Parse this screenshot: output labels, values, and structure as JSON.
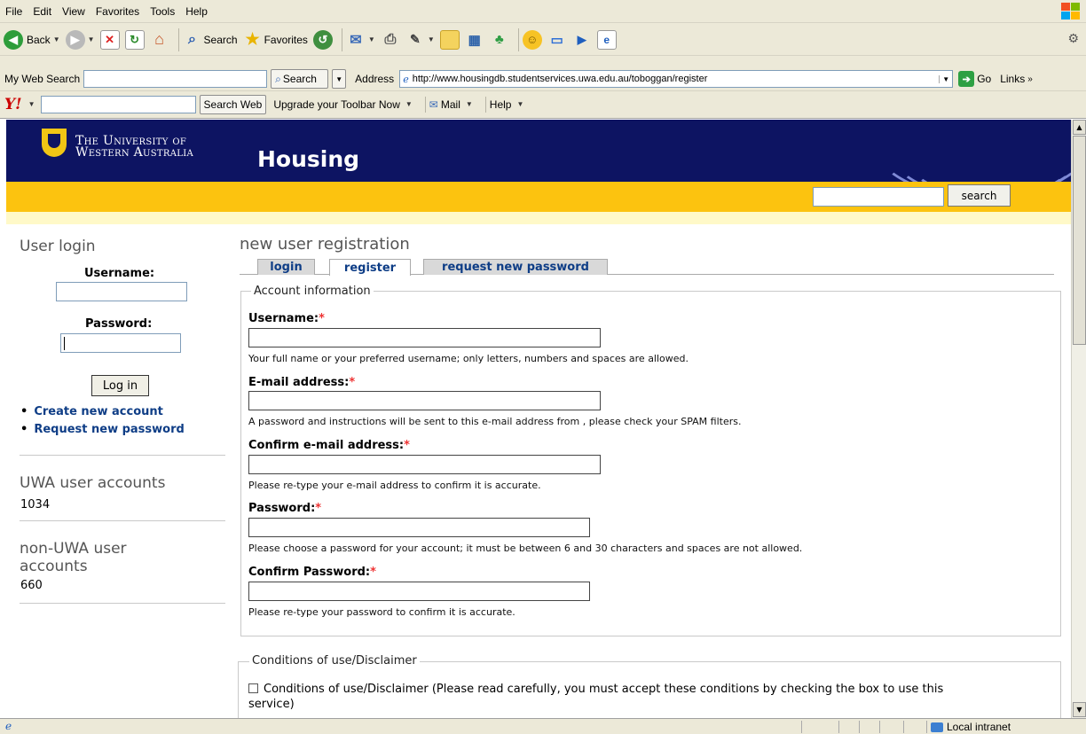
{
  "browser": {
    "menu": [
      "File",
      "Edit",
      "View",
      "Favorites",
      "Tools",
      "Help"
    ],
    "toolbar": {
      "back": "Back",
      "search": "Search",
      "favorites": "Favorites"
    },
    "address_bar": {
      "my_web_search": "My Web Search",
      "search_button": "Search",
      "address_label": "Address",
      "url": "http://www.housingdb.studentservices.uwa.edu.au/toboggan/register",
      "go": "Go",
      "links": "Links"
    },
    "yahoo_bar": {
      "logo": "Y!",
      "search_web": "Search Web",
      "upgrade": "Upgrade your Toolbar Now",
      "mail": "Mail",
      "help": "Help"
    },
    "status": {
      "zone": "Local intranet"
    }
  },
  "header": {
    "university_line1": "The University of",
    "university_line2": "Western Australia",
    "site_title": "Housing",
    "search_button": "search"
  },
  "sidebar": {
    "login_title": "User login",
    "username_label": "Username:",
    "password_label": "Password:",
    "login_button": "Log in",
    "links": [
      "Create new account",
      "Request new password"
    ],
    "uwa_title": "UWA user accounts",
    "uwa_count": "1034",
    "non_uwa_title_line1": "non-UWA user",
    "non_uwa_title_line2": "accounts",
    "non_uwa_count": "660"
  },
  "main": {
    "title": "new user registration",
    "tabs": [
      "login",
      "register",
      "request new password"
    ],
    "account_legend": "Account information",
    "fields": [
      {
        "label": "Username:",
        "hint": "Your full name or your preferred username; only letters, numbers and spaces are allowed."
      },
      {
        "label": "E-mail address:",
        "hint": "A password and instructions will be sent to this e-mail address from , please check your SPAM filters."
      },
      {
        "label": "Confirm e-mail address:",
        "hint": "Please re-type your e-mail address to confirm it is accurate."
      },
      {
        "label": "Password:",
        "hint": "Please choose a password for your account; it must be between 6 and 30 characters and spaces are not allowed."
      },
      {
        "label": "Confirm Password:",
        "hint": "Please re-type your password to confirm it is accurate."
      }
    ],
    "required_mark": "*",
    "conditions_legend": "Conditions of use/Disclaimer",
    "conditions_text_line1": "Conditions of use/Disclaimer (Please read carefully, you must accept these conditions by checking the box to use this",
    "conditions_text_line2": "service)"
  }
}
